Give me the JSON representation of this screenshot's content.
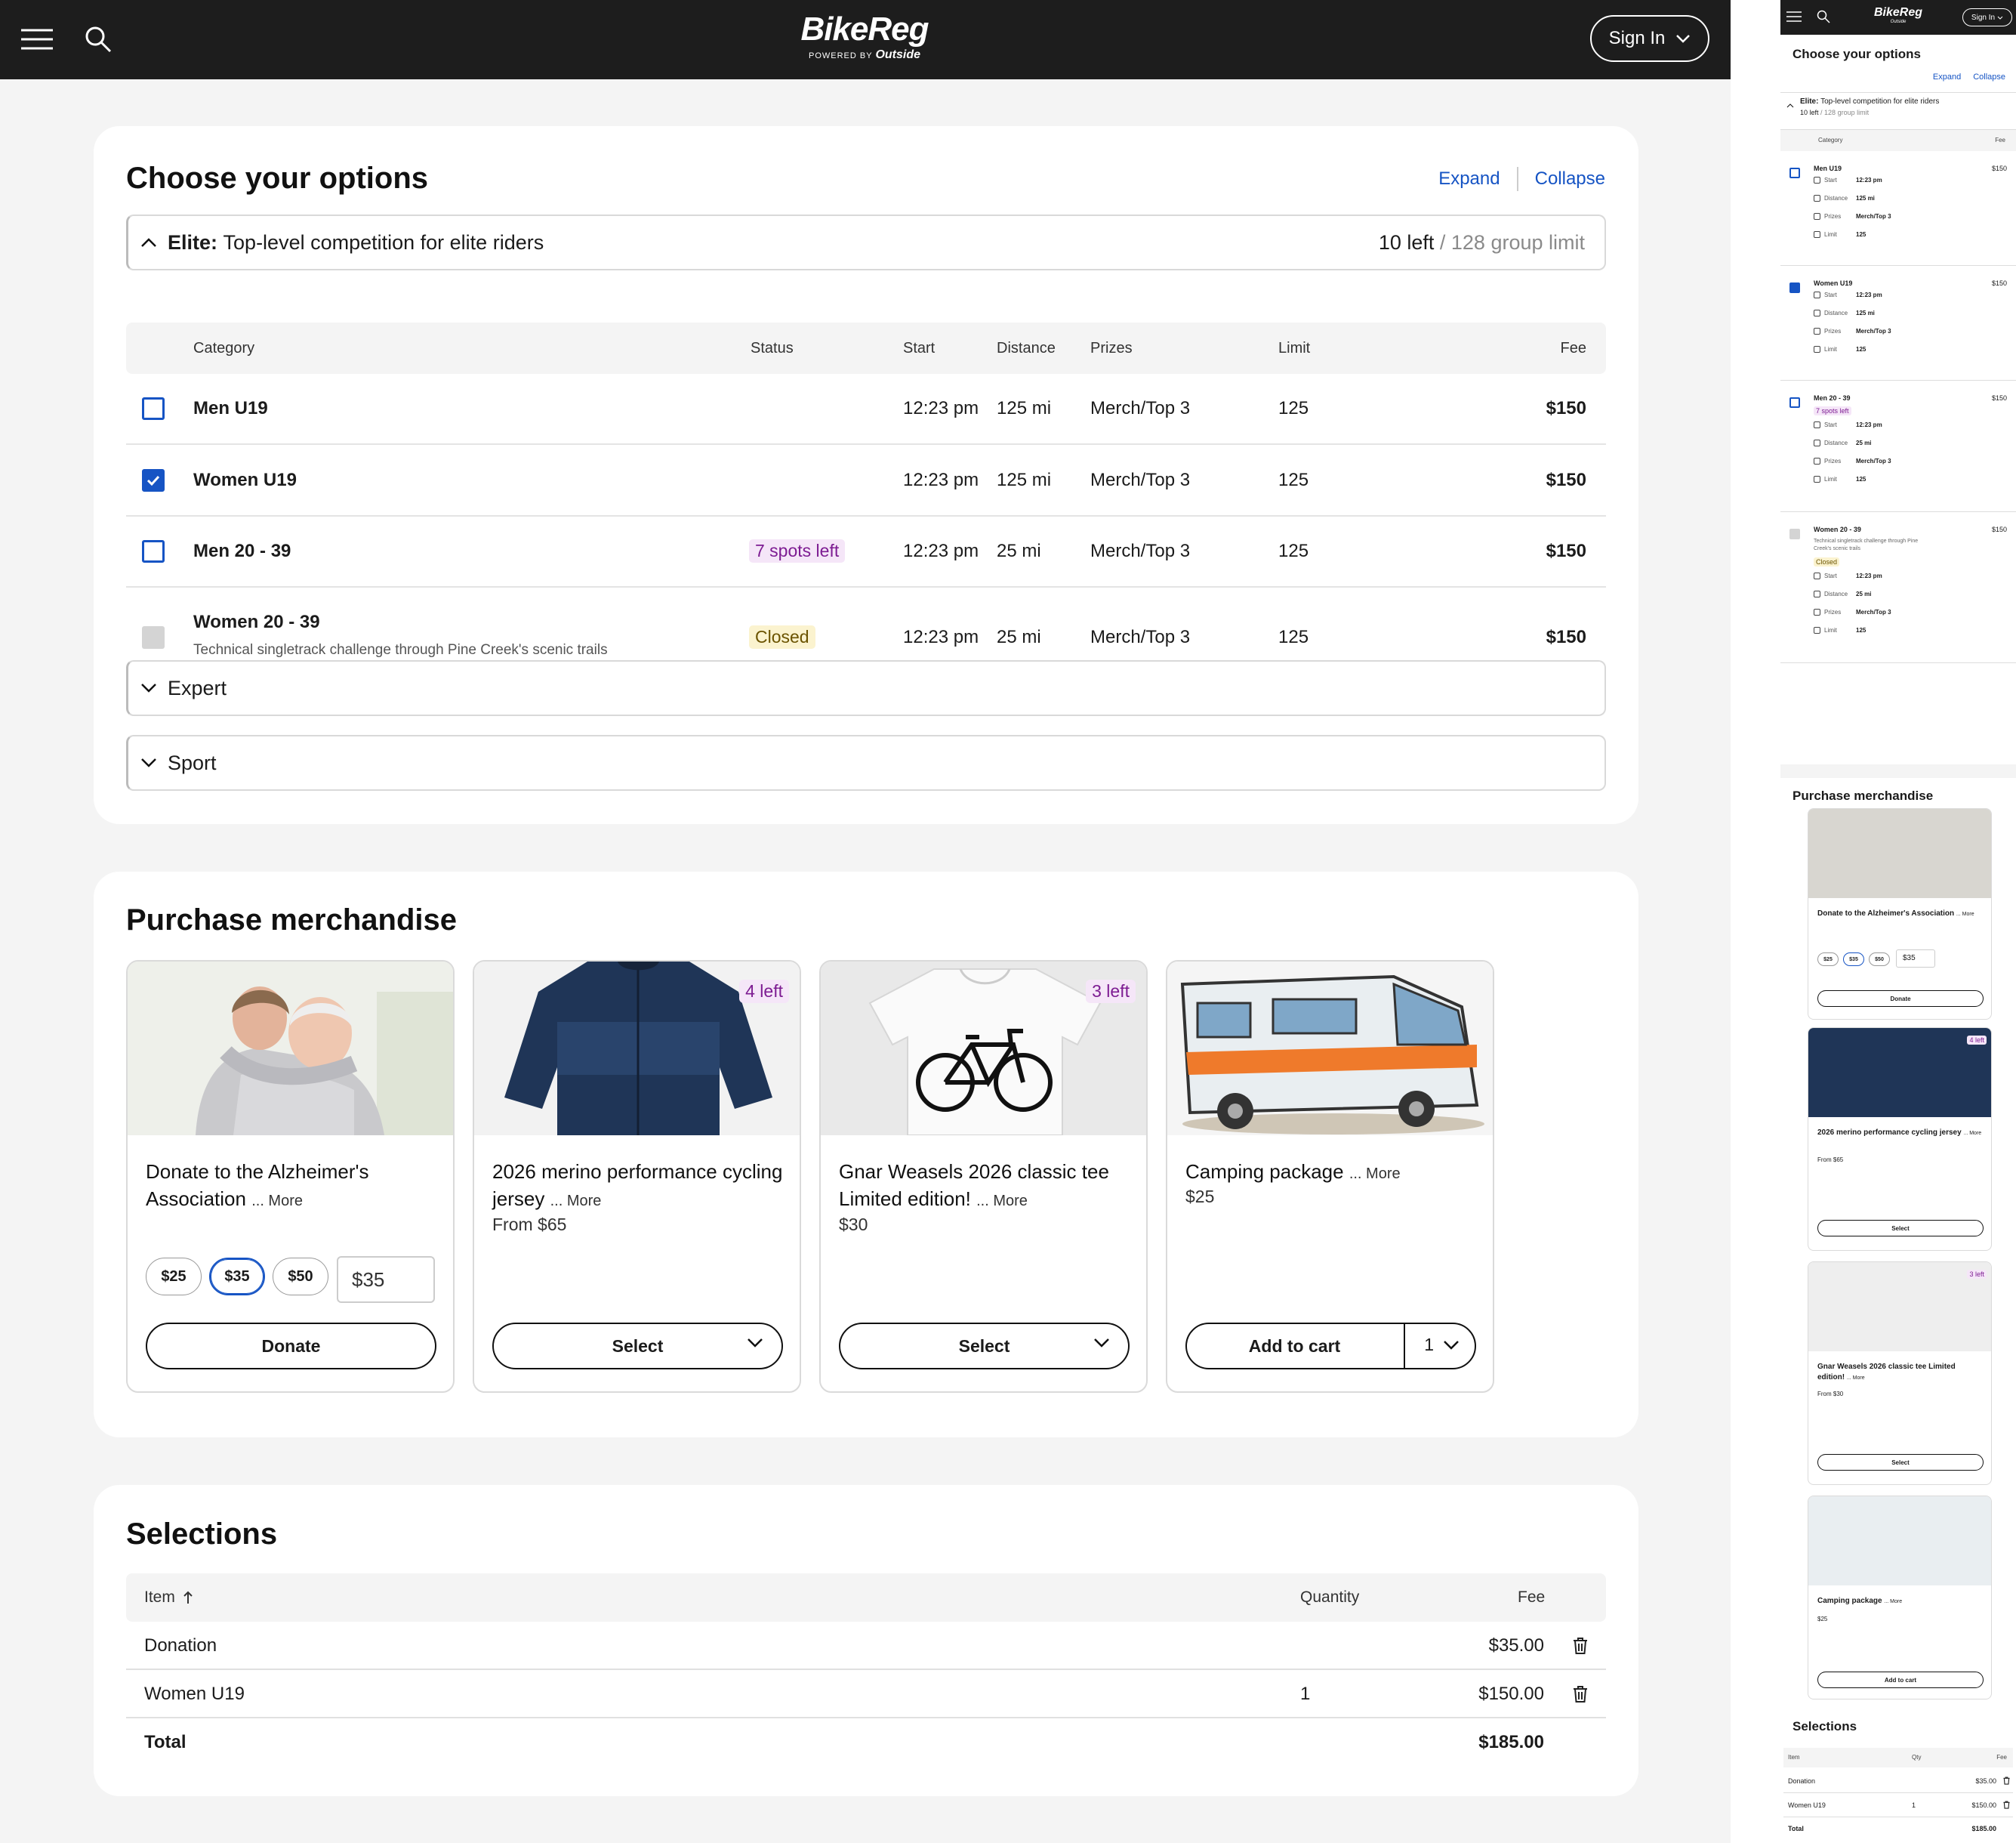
{
  "brand": {
    "name": "BikeReg",
    "powered_by": "POWERED BY",
    "partner": "Outside"
  },
  "header": {
    "sign_in": "Sign In",
    "menu_icon": "hamburger-icon",
    "search_icon": "search-icon"
  },
  "options": {
    "title": "Choose your options",
    "expand": "Expand",
    "collapse": "Collapse",
    "group_elite": {
      "name": "Elite:",
      "desc": "Top-level competition for elite riders",
      "left": "10 left",
      "limit": "/ 128 group limit"
    },
    "columns": {
      "category": "Category",
      "status": "Status",
      "start": "Start",
      "distance": "Distance",
      "prizes": "Prizes",
      "limit": "Limit",
      "fee": "Fee"
    },
    "rows": [
      {
        "category": "Men U19",
        "desc": "",
        "status": "",
        "start": "12:23 pm",
        "distance": "125 mi",
        "prizes": "Merch/Top 3",
        "limit": "125",
        "fee": "$150",
        "checked": false
      },
      {
        "category": "Women U19",
        "desc": "",
        "status": "",
        "start": "12:23 pm",
        "distance": "125 mi",
        "prizes": "Merch/Top 3",
        "limit": "125",
        "fee": "$150",
        "checked": true
      },
      {
        "category": "Men 20 - 39",
        "desc": "",
        "status": "7 spots left",
        "start": "12:23 pm",
        "distance": "25 mi",
        "prizes": "Merch/Top 3",
        "limit": "125",
        "fee": "$150",
        "checked": false
      },
      {
        "category": "Women 20 - 39",
        "desc": "Technical singletrack challenge through Pine Creek's scenic trails",
        "status": "Closed",
        "start": "12:23 pm",
        "distance": "25 mi",
        "prizes": "Merch/Top 3",
        "limit": "125",
        "fee": "$150",
        "checked": false
      }
    ],
    "group_expert": "Expert",
    "group_sport": "Sport"
  },
  "merch": {
    "title": "Purchase merchandise",
    "more": "... More",
    "items": [
      {
        "name": "Donate to the Alzheimer's Association",
        "price": "",
        "badge": "",
        "action": "Donate",
        "amounts": [
          "$25",
          "$35",
          "$50"
        ],
        "selected_amount": "$35",
        "custom_amount": "$35"
      },
      {
        "name": "2026 merino performance cycling jersey",
        "price": "From $65",
        "badge": "4 left",
        "action": "Select"
      },
      {
        "name": "Gnar Weasels 2026 classic tee Limited edition!",
        "price": "$30",
        "badge": "3 left",
        "action": "Select"
      },
      {
        "name": "Camping package",
        "price": "$25",
        "badge": "",
        "action": "Add to cart",
        "qty": "1"
      }
    ]
  },
  "selections": {
    "title": "Selections",
    "columns": {
      "item": "Item",
      "quantity": "Quantity",
      "fee": "Fee"
    },
    "rows": [
      {
        "item": "Donation",
        "qty": "",
        "fee": "$35.00"
      },
      {
        "item": "Women U19",
        "qty": "1",
        "fee": "$150.00"
      }
    ],
    "total_label": "Total",
    "total": "$185.00"
  },
  "mobile": {
    "sign_in": "Sign In",
    "labels": {
      "start": "Start",
      "distance": "Distance",
      "prizes": "Prizes",
      "limit": "Limit"
    },
    "merch_prices": [
      "",
      "From $65",
      "From $30",
      "$25"
    ],
    "col_qty": "Qty"
  },
  "colors": {
    "accent": "#1654c4",
    "header": "#1d1d1d",
    "badge_purple": "#7d1c92",
    "badge_yellow": "#fbf3cf"
  }
}
